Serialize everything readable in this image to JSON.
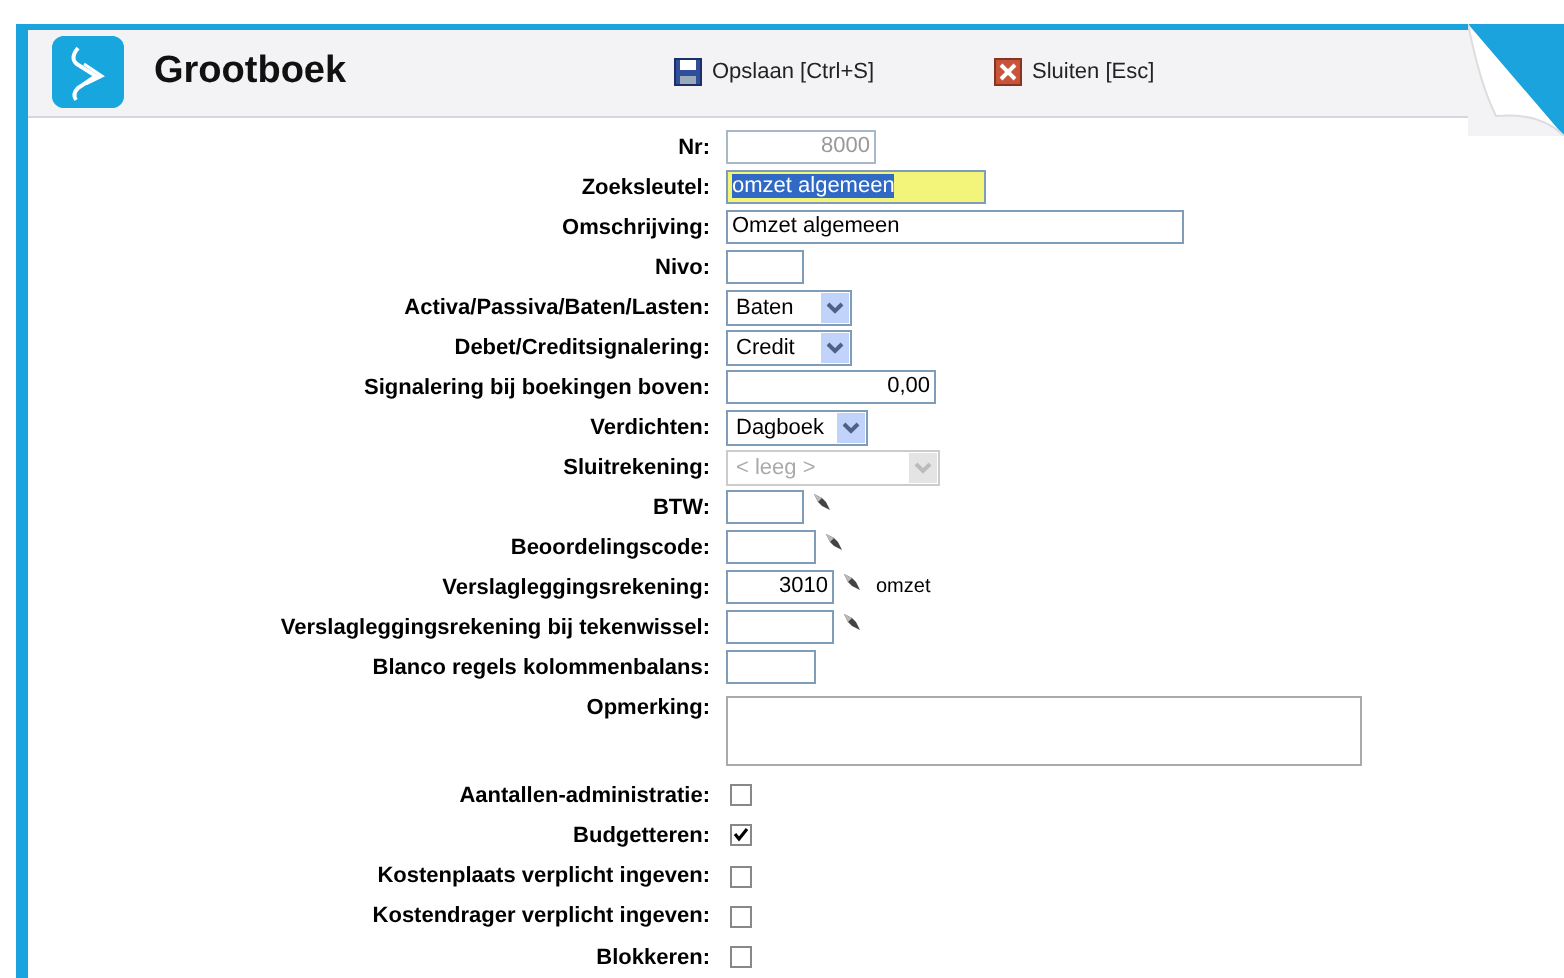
{
  "header": {
    "title": "Grootboek",
    "actions": [
      {
        "kind": "save",
        "label": "Opslaan [Ctrl+S]"
      },
      {
        "kind": "close",
        "label": "Sluiten [Esc]"
      }
    ]
  },
  "fields": [
    {
      "label": "Nr:",
      "kind": "text",
      "value": "8000",
      "right_aligned": true,
      "readonly": true
    },
    {
      "label": "Zoeksleutel:",
      "kind": "text",
      "value": "omzet algemeen",
      "focused": true
    },
    {
      "label": "Omschrijving:",
      "kind": "text",
      "value": "Omzet algemeen"
    },
    {
      "label": "Nivo:",
      "kind": "text"
    },
    {
      "label": "Activa/Passiva/Baten/Lasten:",
      "kind": "select",
      "value": "Baten",
      "disabled": false
    },
    {
      "label": "Debet/Creditsignalering:",
      "kind": "select",
      "value": "Credit",
      "disabled": false
    },
    {
      "label": "Signalering bij boekingen boven:",
      "kind": "text",
      "value": "0,00",
      "right_aligned": true
    },
    {
      "label": "Verdichten:",
      "kind": "select",
      "value": "Dagboek",
      "disabled": false
    },
    {
      "label": "Sluitrekening:",
      "kind": "select",
      "value": "< leeg >",
      "disabled": true
    },
    {
      "label": "BTW:",
      "kind": "text",
      "lookup": true
    },
    {
      "label": "Beoordelingscode:",
      "kind": "text",
      "lookup": true
    },
    {
      "label": "Verslagleggingsrekening:",
      "kind": "text",
      "value": "3010",
      "right_aligned": true,
      "lookup": true,
      "note": "omzet"
    },
    {
      "label": "Verslagleggingsrekening bij tekenwissel:",
      "kind": "text",
      "lookup": true
    },
    {
      "label": "Blanco regels kolommenbalans:",
      "kind": "text"
    },
    {
      "label": "Opmerking:",
      "kind": "textarea"
    },
    {
      "label": "Aantallen-administratie:",
      "kind": "checkbox",
      "checked": false
    },
    {
      "label": "Budgetteren:",
      "kind": "checkbox",
      "checked": true
    },
    {
      "label": "Kostenplaats verplicht ingeven:",
      "kind": "checkbox",
      "checked": false
    },
    {
      "label": "Kostendrager verplicht ingeven:",
      "kind": "checkbox",
      "checked": false
    },
    {
      "label": "Blokkeren:",
      "kind": "checkbox",
      "checked": false
    }
  ]
}
